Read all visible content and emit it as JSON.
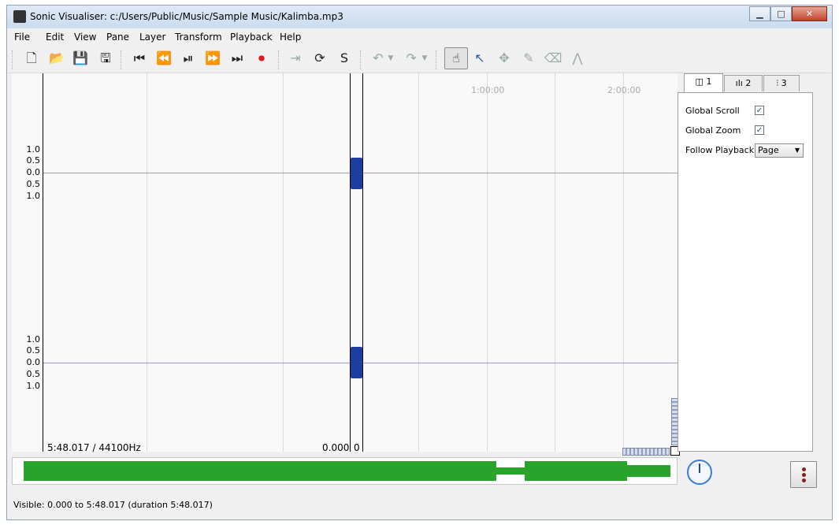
{
  "window": {
    "title": "Sonic Visualiser: c:/Users/Public/Music/Sample Music/Kalimba.mp3",
    "controls": [
      "minimize-icon",
      "maximize-icon",
      "close-icon"
    ]
  },
  "menu": [
    "File",
    "Edit",
    "View",
    "Pane",
    "Layer",
    "Transform",
    "Playback",
    "Help"
  ],
  "toolbar": {
    "file_icons": [
      "new-file-icon",
      "open-folder-icon",
      "save-icon",
      "save-as-icon"
    ],
    "transport_icons": [
      "rewind-start-icon",
      "rewind-icon",
      "play-pause-icon",
      "fast-forward-icon",
      "forward-end-icon",
      "record-icon"
    ],
    "play_mode_icons": [
      "play-selection-icon",
      "loop-icon",
      "solo-icon"
    ],
    "edit_icons": [
      "undo-icon",
      "redo-icon"
    ],
    "tool_icons": [
      "navigate-tool-icon",
      "select-tool-icon",
      "move-tool-icon",
      "draw-tool-icon",
      "erase-tool-icon",
      "measure-tool-icon"
    ]
  },
  "pane": {
    "time_markers": [
      "1:00:00",
      "2:00:00"
    ],
    "scale_top": [
      "1.0",
      "0.5",
      "0.0",
      "0.5",
      "1.0"
    ],
    "scale_bottom": [
      "1.0",
      "0.5",
      "0.0",
      "0.5",
      "1.0"
    ],
    "duration_samplerate": "5:48.017 / 44100Hz",
    "cursor_time": "0.000",
    "cursor_frame": "0"
  },
  "properties": {
    "tabs": [
      {
        "icon": "pane-icon",
        "label": "1"
      },
      {
        "icon": "spectrum-icon",
        "label": "2"
      },
      {
        "icon": "waveform-icon",
        "label": "3"
      }
    ],
    "global_scroll_label": "Global Scroll",
    "global_scroll_checked": true,
    "global_zoom_label": "Global Zoom",
    "global_zoom_checked": true,
    "follow_playback_label": "Follow Playback",
    "follow_playback_value": "Page"
  },
  "status": {
    "visible": "Visible: 0.000 to 5:48.017 (duration 5:48.017)"
  },
  "colors": {
    "waveform": "#1c3ea0",
    "overview_waveform": "#2aa32a",
    "record": "#e01b1b"
  }
}
